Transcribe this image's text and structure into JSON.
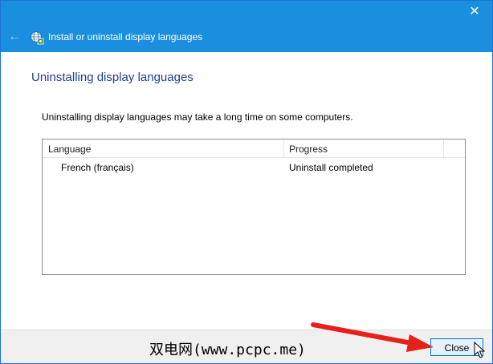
{
  "window": {
    "title": "Install or uninstall display languages",
    "close_glyph": "✕",
    "back_glyph": "←",
    "accent_color": "#1a8fe0"
  },
  "page": {
    "heading": "Uninstalling display languages",
    "description": "Uninstalling display languages may take a long time on some computers."
  },
  "table": {
    "columns": [
      "Language",
      "Progress"
    ],
    "rows": [
      {
        "language": "French (français)",
        "progress": "Uninstall completed"
      }
    ]
  },
  "footer": {
    "watermark": "双电网(www.pcpc.me)",
    "close_label": "Close"
  },
  "icons": {
    "app": "globe-settings-icon",
    "back": "back-arrow-icon",
    "annotation": "red-arrow-icon",
    "cursor": "mouse-cursor-icon"
  }
}
